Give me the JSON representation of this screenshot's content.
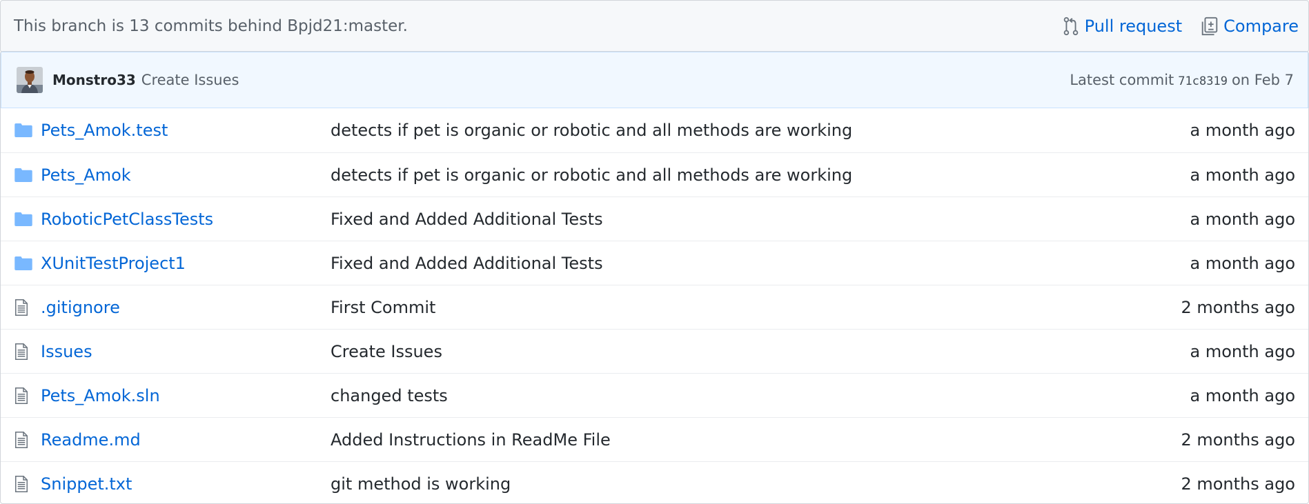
{
  "branch_info": {
    "text": "This branch is 13 commits behind Bpjd21:master.",
    "pull_request_label": "Pull request",
    "compare_label": "Compare"
  },
  "latest_commit": {
    "author": "Monstro33",
    "message": "Create Issues",
    "prefix": "Latest commit",
    "sha": "71c8319",
    "date": "on Feb 7"
  },
  "colors": {
    "link": "#0366d6",
    "folder_icon": "#79b8ff",
    "commit_bar_bg": "#f1f8ff"
  },
  "files": [
    {
      "type": "folder",
      "icon": "folder-icon",
      "name": "Pets_Amok.test",
      "message": "detects if pet is organic or robotic and all methods are working",
      "age": "a month ago"
    },
    {
      "type": "folder",
      "icon": "folder-icon",
      "name": "Pets_Amok",
      "message": "detects if pet is organic or robotic and all methods are working",
      "age": "a month ago"
    },
    {
      "type": "folder",
      "icon": "folder-icon",
      "name": "RoboticPetClassTests",
      "message": "Fixed and Added Additional Tests",
      "age": "a month ago"
    },
    {
      "type": "folder",
      "icon": "folder-icon",
      "name": "XUnitTestProject1",
      "message": "Fixed and Added Additional Tests",
      "age": "a month ago"
    },
    {
      "type": "file",
      "icon": "file-icon",
      "name": ".gitignore",
      "message": "First Commit",
      "age": "2 months ago"
    },
    {
      "type": "file",
      "icon": "file-icon",
      "name": "Issues",
      "message": "Create Issues",
      "age": "a month ago"
    },
    {
      "type": "file",
      "icon": "file-icon",
      "name": "Pets_Amok.sln",
      "message": "changed tests",
      "age": "a month ago"
    },
    {
      "type": "file",
      "icon": "file-icon",
      "name": "Readme.md",
      "message": "Added Instructions in ReadMe File",
      "age": "2 months ago"
    },
    {
      "type": "file",
      "icon": "file-icon",
      "name": "Snippet.txt",
      "message": "git method is working",
      "age": "2 months ago"
    }
  ]
}
